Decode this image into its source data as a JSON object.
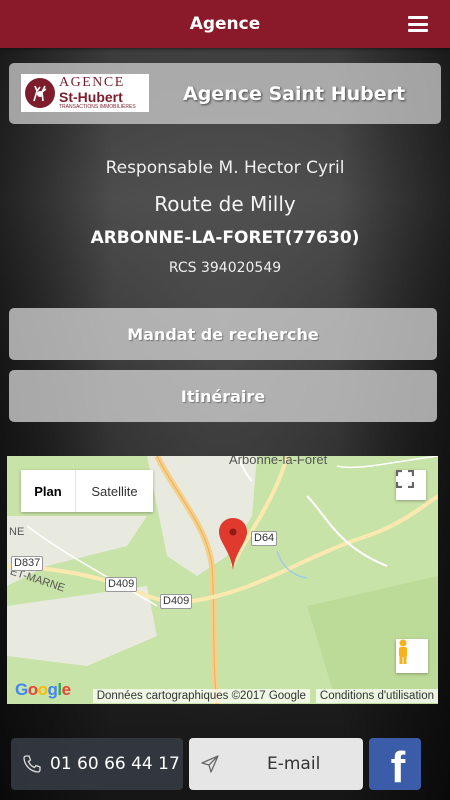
{
  "header": {
    "title": "Agence"
  },
  "agency": {
    "logo": {
      "line1": "AGENCE",
      "line2": "St-Hubert",
      "line3": "TRANSACTIONS IMMOBILIÈRES"
    },
    "name": "Agence Saint Hubert"
  },
  "info": {
    "responsable": "Responsable M. Hector Cyril",
    "street": "Route de Milly",
    "city": "ARBONNE-LA-FORET(77630)",
    "rcs": "RCS 394020549"
  },
  "buttons": {
    "mandat": "Mandat de recherche",
    "itineraire": "Itinéraire"
  },
  "map": {
    "type_plan": "Plan",
    "type_satellite": "Satellite",
    "place_name": "Arbonne-la-Forêt",
    "region_fragment": "ET-MARNE",
    "region_fragment2": "NE",
    "roads": {
      "d837": "D837",
      "d409a": "D409",
      "d409b": "D409",
      "d64": "D64"
    },
    "attribution": "Données cartographiques ©2017 Google",
    "terms": "Conditions d'utilisation",
    "google_logo": "Google",
    "colors": {
      "land": "#c8e3a8",
      "road": "#f6cf8a",
      "marker": "#e0392e"
    }
  },
  "contact": {
    "phone": "01 60 66 44 17",
    "email": "E-mail",
    "facebook_icon": "facebook-icon"
  },
  "colors": {
    "brand": "#8a1a2a",
    "facebook": "#3b5ca8"
  }
}
